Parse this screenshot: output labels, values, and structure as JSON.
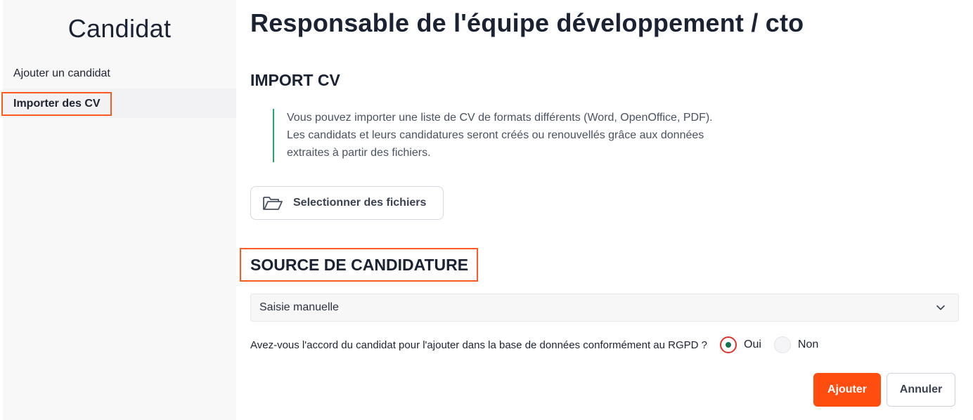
{
  "sidebar": {
    "title": "Candidat",
    "items": [
      {
        "label": "Ajouter un candidat"
      },
      {
        "label": "Importer des CV",
        "active": true
      }
    ]
  },
  "main": {
    "page_title": "Responsable de l'équipe développement / cto",
    "import_cv": {
      "title": "IMPORT CV",
      "info_lines": [
        "Vous pouvez importer une liste de CV de formats différents (Word, OpenOffice, PDF).",
        "Les candidats et leurs candidatures seront créés ou renouvellés grâce aux données",
        "extraites à partir des fichiers."
      ],
      "select_files_label": "Selectionner des fichiers",
      "select_files_icon": "folder-open-icon"
    },
    "source": {
      "title": "SOURCE DE CANDIDATURE",
      "selected_value": "Saisie manuelle"
    },
    "rgpd": {
      "question": "Avez-vous l'accord du candidat pour l'ajouter dans la base de données conformément au RGPD ?",
      "options": [
        {
          "label": "Oui",
          "checked": true
        },
        {
          "label": "Non",
          "checked": false
        }
      ]
    },
    "actions": {
      "submit_label": "Ajouter",
      "cancel_label": "Annuler"
    }
  },
  "colors": {
    "accent": "#ff4d0f",
    "highlight_border": "#ff5a1f",
    "info_border": "#27a36f",
    "radio_checked_dot": "#17724f",
    "radio_checked_ring": "#e0342b"
  }
}
